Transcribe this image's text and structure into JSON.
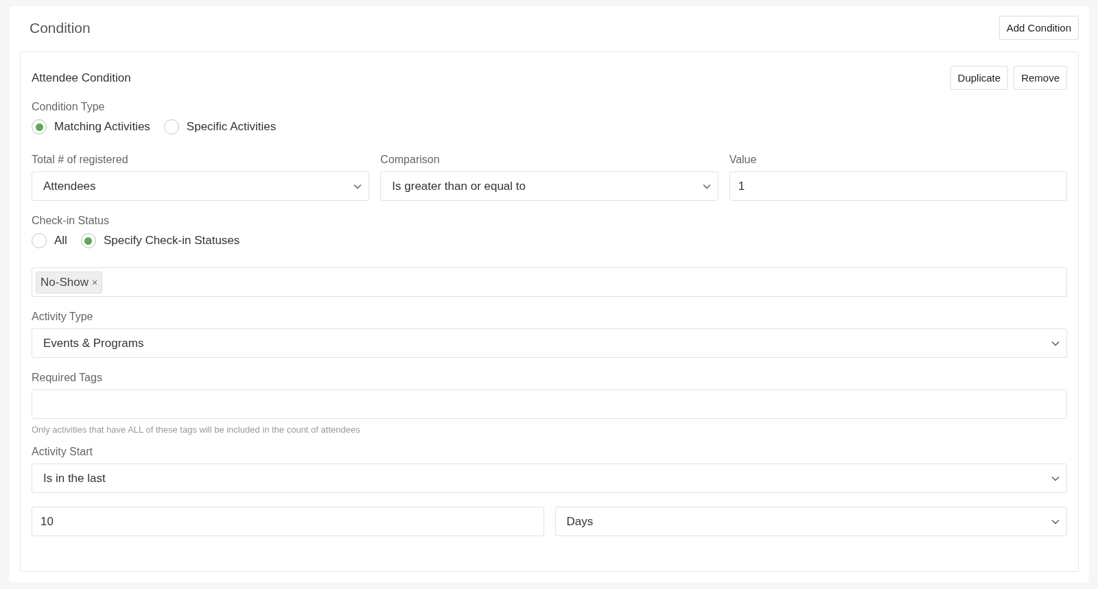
{
  "title": "Condition",
  "add_button": "Add Condition",
  "condition": {
    "title": "Attendee Condition",
    "buttons": [
      "Duplicate",
      "Remove"
    ],
    "fields": [
      {
        "kind": "radio",
        "label": "Condition Type",
        "options": [
          {
            "label": "Matching Activities",
            "selected": true
          },
          {
            "label": "Specific Activities",
            "selected": false
          }
        ]
      },
      {
        "kind": "row",
        "columns": [
          {
            "kind": "select",
            "label": "Total # of registered",
            "value": "Attendees"
          },
          {
            "kind": "select",
            "label": "Comparison",
            "value": "Is greater than or equal to"
          },
          {
            "kind": "input",
            "label": "Value",
            "value": "1"
          }
        ]
      },
      {
        "kind": "radio",
        "label": "Check-in Status",
        "options": [
          {
            "label": "All",
            "selected": false
          },
          {
            "label": "Specify Check-in Statuses",
            "selected": true
          }
        ]
      },
      {
        "kind": "tags",
        "tags": [
          {
            "label": "No-Show",
            "remove": "×"
          }
        ]
      },
      {
        "kind": "select",
        "label": "Activity Type",
        "value": "Events & Programs"
      },
      {
        "kind": "tags",
        "label": "Required Tags",
        "hint": "Only activities that have ALL of these tags will be included in the count of attendees"
      },
      {
        "kind": "select",
        "label": "Activity Start",
        "value": "Is in the last"
      },
      {
        "kind": "row",
        "columns": [
          {
            "kind": "input",
            "value": "10"
          },
          {
            "kind": "select",
            "value": "Days"
          }
        ]
      }
    ]
  }
}
